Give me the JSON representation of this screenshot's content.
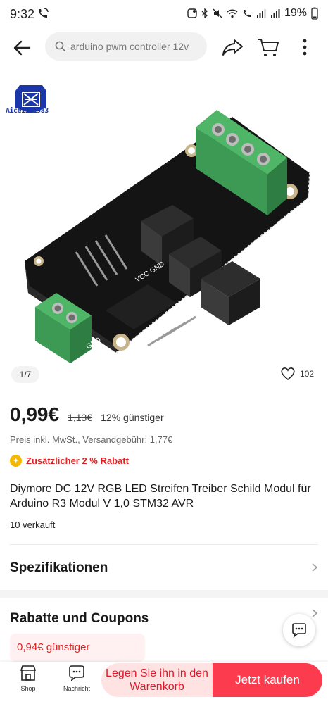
{
  "status_bar": {
    "time": "9:32",
    "battery": "19%"
  },
  "header": {
    "search_placeholder": "arduino pwm controller 12v"
  },
  "gallery": {
    "brand_text": "Aice1101983",
    "counter": "1/7",
    "likes": "102"
  },
  "price": {
    "current": "0,99€",
    "original": "1,13€",
    "discount": "12% günstiger",
    "tax_note": "Preis inkl. MwSt., Versandgebühr: 1,77€",
    "extra_discount": "Zusätzlicher 2 % Rabatt"
  },
  "product": {
    "title": "Diymore DC 12V RGB LED Streifen Treiber Schild Modul für Arduino R3 Modul V 1,0 STM32 AVR",
    "sold": "10 verkauft"
  },
  "sections": {
    "specs_label": "Spezifikationen",
    "coupons_label": "Rabatte und Coupons",
    "coupon_chip": "0,94€ günstiger"
  },
  "bottom_bar": {
    "shop_label": "Shop",
    "message_label": "Nachricht",
    "add_to_cart": "Legen Sie ihn in den Warenkorb",
    "buy_now": "Jetzt kaufen"
  },
  "colors": {
    "accent_red": "#fd3b4e",
    "discount_red": "#e02020",
    "badge_gold": "#f5b800",
    "pcb_black": "#141414",
    "terminal_green": "#3c9a55"
  }
}
